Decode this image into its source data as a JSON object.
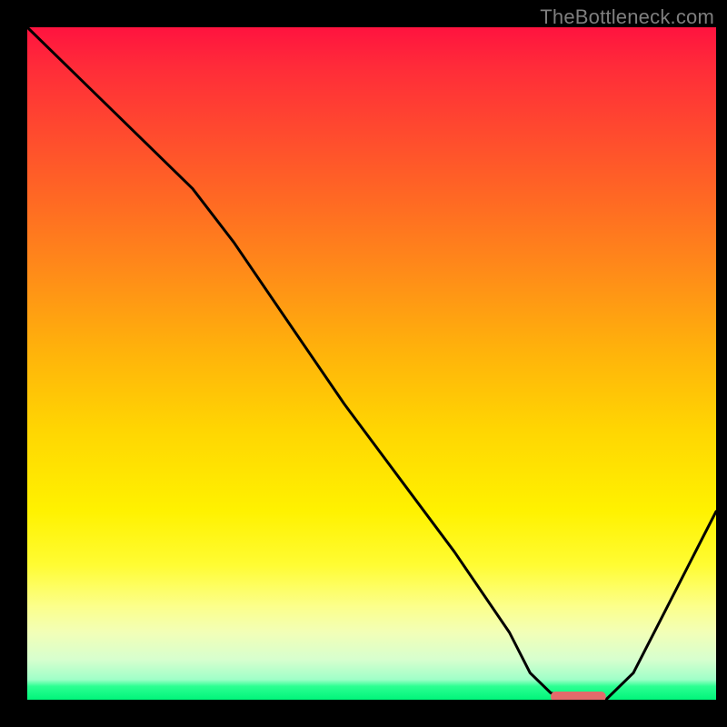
{
  "watermark": "TheBottleneck.com",
  "chart_data": {
    "type": "line",
    "title": "",
    "xlabel": "",
    "ylabel": "",
    "xlim": [
      0,
      100
    ],
    "ylim": [
      0,
      100
    ],
    "background_gradient": {
      "top": "#ff133f",
      "upper_mid": "#ffb20b",
      "lower_mid": "#fffc33",
      "bottom": "#00f57a"
    },
    "series": [
      {
        "name": "bottleneck-curve",
        "x": [
          0,
          8,
          16,
          24,
          30,
          38,
          46,
          54,
          62,
          70,
          73,
          76,
          80,
          84,
          88,
          92,
          96,
          100
        ],
        "y": [
          100,
          92,
          84,
          76,
          68,
          56,
          44,
          33,
          22,
          10,
          4,
          1,
          0,
          0,
          4,
          12,
          20,
          28
        ]
      }
    ],
    "optimum_marker": {
      "name": "optimum-range",
      "x": [
        76,
        84
      ],
      "y": 0,
      "color": "#e36b6b"
    }
  }
}
